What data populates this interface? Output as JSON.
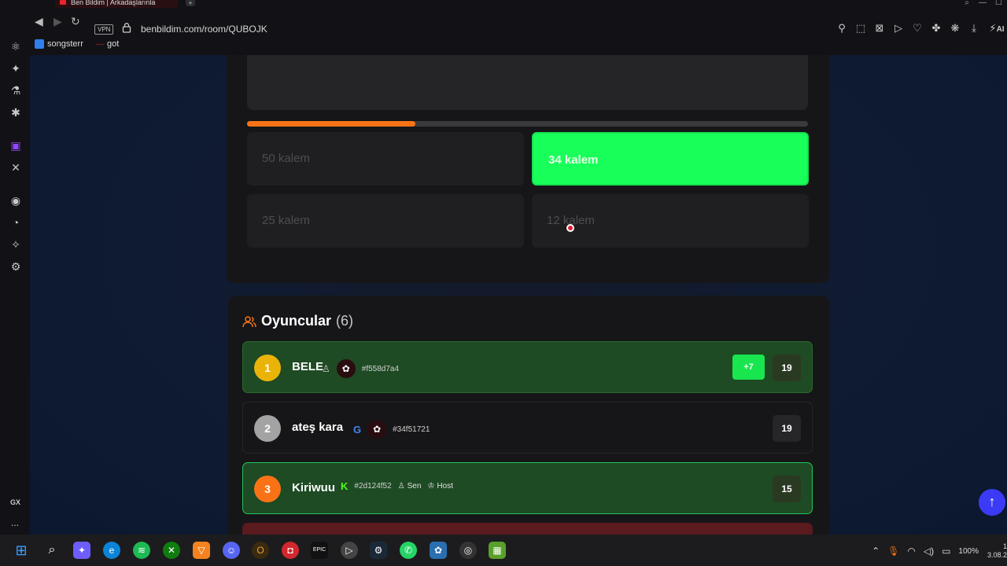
{
  "browser": {
    "tab_title": "Ben Bildim | Arkadaşlarınla",
    "new_tab_label": "+",
    "url": "benbildim.com/room/QUBOJK",
    "vpn_label": "VPN",
    "ai_label": "AI",
    "bookmarks": [
      {
        "label": "songsterr"
      },
      {
        "label": "got"
      }
    ]
  },
  "sidebar": {
    "gx_label": "GX",
    "more_label": "..."
  },
  "quiz": {
    "progress_fraction": 0.3,
    "accent_color": "#f97316",
    "options": [
      {
        "label": "50 kalem",
        "state": "idle"
      },
      {
        "label": "34 kalem",
        "state": "correct"
      },
      {
        "label": "25 kalem",
        "state": "idle"
      },
      {
        "label": "12 kalem",
        "state": "idle"
      }
    ]
  },
  "players": {
    "title": "Oyuncular",
    "count": "(6)",
    "rows": [
      {
        "rank": "1",
        "name": "BELE",
        "hash": "#f558d7a4",
        "delta": "+7",
        "score": "19",
        "rank_color": "#eab308"
      },
      {
        "rank": "2",
        "name": "ateş kara",
        "hash": "#34f51721",
        "score": "19",
        "rank_color": "#a3a3a3"
      },
      {
        "rank": "3",
        "name": "Kiriwuu",
        "hash": "#2d124f52",
        "you_label": "Sen",
        "host_label": "Host",
        "score": "15",
        "rank_color": "#f97316"
      }
    ]
  },
  "taskbar": {
    "battery": "100%",
    "clock_top": "1",
    "clock_bottom": "3.08.2"
  }
}
